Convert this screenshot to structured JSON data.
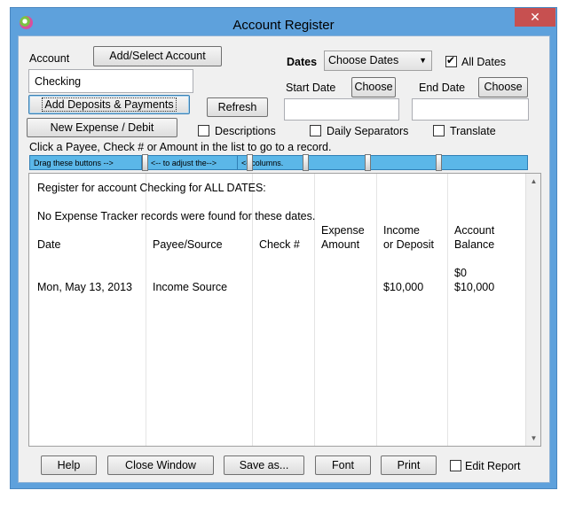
{
  "window": {
    "title": "Account Register",
    "close_glyph": "✕"
  },
  "account": {
    "label": "Account",
    "add_select_label": "Add/Select Account",
    "value": "Checking"
  },
  "buttons": {
    "add_deposits": "Add Deposits & Payments",
    "new_expense": "New Expense / Debit",
    "refresh": "Refresh"
  },
  "dates": {
    "label": "Dates",
    "selected": "Choose Dates",
    "all_dates_label": "All Dates",
    "all_dates_checked": true,
    "start_label": "Start Date",
    "end_label": "End Date",
    "choose_label": "Choose",
    "start_value": "",
    "end_value": ""
  },
  "options": {
    "descriptions": "Descriptions",
    "daily_separators": "Daily Separators",
    "translate": "Translate"
  },
  "hint": "Click a Payee, Check # or Amount in the list to go to a record.",
  "column_adjust": [
    "Drag these buttons -->",
    "<-- to adjust the-->",
    "<--columns."
  ],
  "register": {
    "heading": "Register for account Checking  for ALL DATES:",
    "notice": "No Expense Tracker records were found for these dates.",
    "headers": {
      "date": "Date",
      "payee": "Payee/Source",
      "check": "Check #",
      "expense_1": "Expense",
      "expense_2": "Amount",
      "income_1": "Income",
      "income_2": "or Deposit",
      "balance_1": "Account",
      "balance_2": "Balance"
    },
    "opening_balance": "$0",
    "rows": [
      {
        "date": "Mon, May 13, 2013",
        "payee": "Income Source",
        "check": "",
        "expense": "",
        "income": "$10,000",
        "balance": "$10,000"
      }
    ]
  },
  "footer": {
    "help": "Help",
    "close_window": "Close Window",
    "save_as": "Save as...",
    "font": "Font",
    "print": "Print",
    "edit_report": "Edit Report",
    "edit_report_checked": false
  },
  "colors": {
    "frame": "#5ea1dc",
    "column_bar": "#5bb7e8",
    "close": "#c75050"
  }
}
